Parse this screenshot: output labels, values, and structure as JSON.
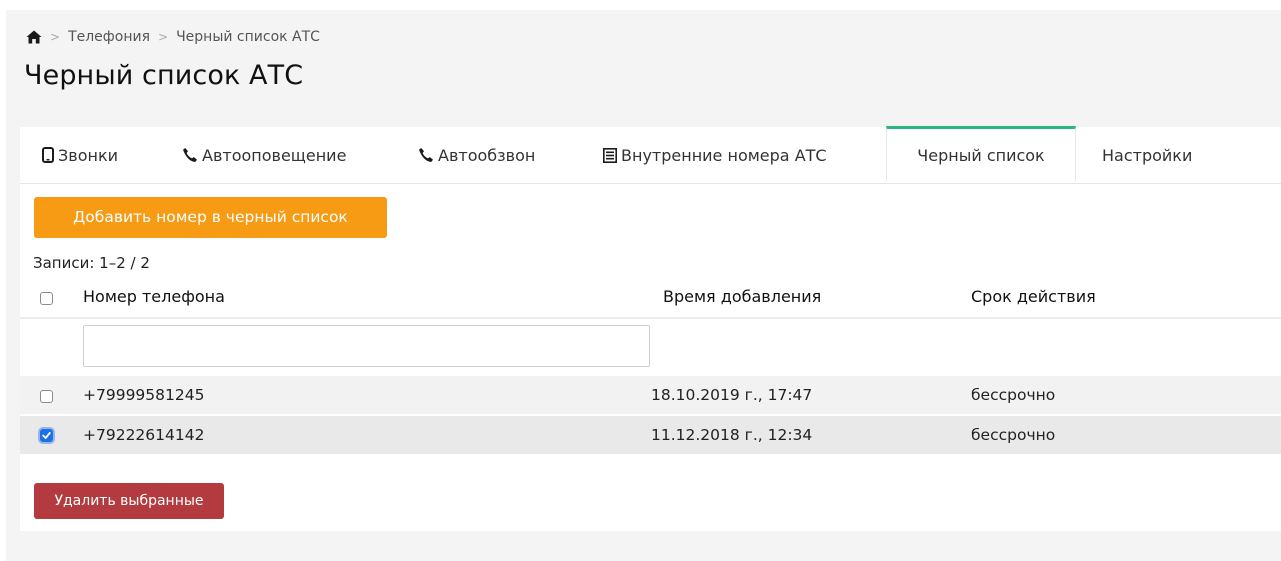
{
  "breadcrumb": {
    "home_icon": "home-icon",
    "items": [
      "Телефония",
      "Черный список АТС"
    ],
    "separator": ">"
  },
  "page": {
    "title": "Черный список АТС"
  },
  "tabs": [
    {
      "label": "Звонки",
      "icon": "mobile-phone-icon"
    },
    {
      "label": "Автооповещение",
      "icon": "phone-icon"
    },
    {
      "label": "Автообзвон",
      "icon": "phone-icon"
    },
    {
      "label": "Внутренние номера АТС",
      "icon": "list-icon"
    },
    {
      "label": "Черный список",
      "active": true
    },
    {
      "label": "Настройки"
    }
  ],
  "actions": {
    "add_label": "Добавить номер в черный список",
    "delete_label": "Удалить выбранные"
  },
  "summary": {
    "records_text": "Записи: 1–2 / 2"
  },
  "table": {
    "columns": [
      "Номер телефона",
      "Время добавления",
      "Срок действия"
    ],
    "filter": {
      "phone_value": ""
    },
    "rows": [
      {
        "phone": "+79999581245",
        "added": "18.10.2019 г., 17:47",
        "validity": "бессрочно",
        "checked": false
      },
      {
        "phone": "+79222614142",
        "added": "11.12.2018 г., 12:34",
        "validity": "бессрочно",
        "checked": true
      }
    ]
  },
  "colors": {
    "accent_green": "#2cb67d",
    "add_button": "#f79a14",
    "delete_button": "#b33b3f",
    "checkbox_checked": "#1f6fe5"
  }
}
